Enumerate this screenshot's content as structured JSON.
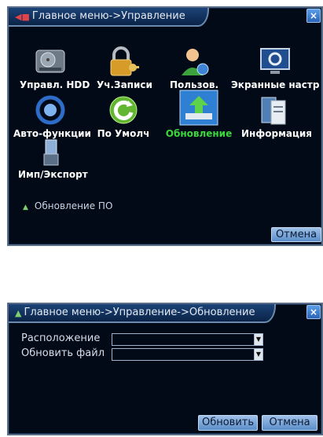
{
  "dialog_main": {
    "title": "Главное меню->Управление",
    "items": [
      {
        "label": "Управл. HDD",
        "icon": "hdd-icon"
      },
      {
        "label": "Уч.Записи",
        "icon": "lock-key-icon"
      },
      {
        "label": "Пользов.",
        "icon": "user-icon"
      },
      {
        "label": "Экранные настр",
        "icon": "display-settings-icon"
      },
      {
        "label": "Авто-функции",
        "icon": "auto-function-icon"
      },
      {
        "label": "По Умолч",
        "icon": "reset-default-icon"
      },
      {
        "label": "Обновление",
        "icon": "upgrade-icon"
      },
      {
        "label": "Информация",
        "icon": "info-icon"
      },
      {
        "label": "Имп/Экспорт",
        "icon": "usb-import-export-icon"
      }
    ],
    "selected_index": 6,
    "status_text": "Обновление ПО",
    "cancel_label": "Отмена"
  },
  "dialog_upgrade": {
    "title": "Главное меню->Управление->Обновление",
    "location_label": "Расположение",
    "file_label": "Обновить файл",
    "location_value": "",
    "file_value": "",
    "update_label": "Обновить",
    "cancel_label": "Отмена"
  },
  "colors": {
    "panel_bg": "#020a18",
    "selected_label": "#3cd73c",
    "title_tab": "#1a4377"
  }
}
